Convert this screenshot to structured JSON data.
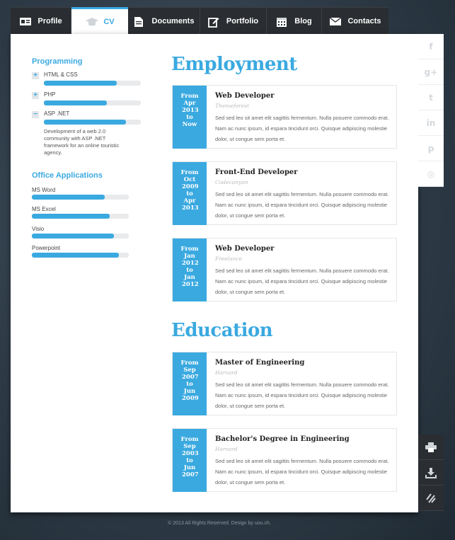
{
  "tabs": [
    {
      "label": "Profile",
      "icon": "id-card-icon"
    },
    {
      "label": "CV",
      "icon": "graduation-cap-icon"
    },
    {
      "label": "Documents",
      "icon": "document-icon"
    },
    {
      "label": "Portfolio",
      "icon": "edit-icon"
    },
    {
      "label": "Blog",
      "icon": "calendar-icon"
    },
    {
      "label": "Contacts",
      "icon": "envelope-icon"
    }
  ],
  "sidebar": {
    "programming_title": "Programming",
    "programming": [
      {
        "toggle": "+",
        "label": "HTML & CSS",
        "level": 0.75
      },
      {
        "toggle": "+",
        "label": "PHP",
        "level": 0.65
      },
      {
        "toggle": "−",
        "label": "ASP .NET",
        "level": 0.85,
        "description": "Development of a web 2.0 community with ASP .NET framework for an online touristic agency."
      }
    ],
    "office_title": "Office Applications",
    "office": [
      {
        "label": "MS Word",
        "level": 0.75
      },
      {
        "label": "MS Excel",
        "level": 0.8
      },
      {
        "label": "Visio",
        "level": 0.85
      },
      {
        "label": "Powerpoint",
        "level": 0.9
      }
    ]
  },
  "employment": {
    "title": "Employment",
    "entries": [
      {
        "from_label": "From",
        "from": "Apr 2013",
        "to_label": "to",
        "to": "Now",
        "title": "Web Developer",
        "org": "Themeforest",
        "body": "Sed sed leo sit amet elit sagittis fermentum. Nulla posuere commodo erat. Nam ac nunc ipsum, id espara tincidunt orci. Quisque adipiscing molestie dolor, ut congue sem porta et."
      },
      {
        "from_label": "From",
        "from": "Oct 2009",
        "to_label": "to",
        "to": "Apr 2013",
        "title": "Front-End Developer",
        "org": "Codecanyon",
        "body": "Sed sed leo sit amet elit sagittis fermentum. Nulla posuere commodo erat. Nam ac nunc ipsum, id espara tincidunt orci. Quisque adipiscing molestie dolor, ut congue sem porta et."
      },
      {
        "from_label": "From",
        "from": "Jan 2012",
        "to_label": "to",
        "to": "Jan 2012",
        "title": "Web Developer",
        "org": "Freelance",
        "body": "Sed sed leo sit amet elit sagittis fermentum. Nulla posuere commodo erat. Nam ac nunc ipsum, id espara tincidunt orci. Quisque adipiscing molestie dolor, ut congue sem porta et."
      }
    ]
  },
  "education": {
    "title": "Education",
    "entries": [
      {
        "from_label": "From",
        "from": "Sep 2007",
        "to_label": "to",
        "to": "Jun 2009",
        "title": "Master of Engineering",
        "org": "Harvard",
        "body": "Sed sed leo sit amet elit sagittis fermentum. Nulla posuere commodo erat. Nam ac nunc ipsum, id espara tincidunt orci. Quisque adipiscing molestie dolor, ut congue sem porta et."
      },
      {
        "from_label": "From",
        "from": "Sep 2003",
        "to_label": "to",
        "to": "Jun 2007",
        "title": "Bachelor's Degree in Engineering",
        "org": "Harvard",
        "body": "Sed sed leo sit amet elit sagittis fermentum. Nulla posuere commodo erat. Nam ac nunc ipsum, id espara tincidunt orci. Quisque adipiscing molestie dolor, ut congue sem porta et."
      }
    ]
  },
  "social": [
    {
      "glyph": "f",
      "icon": "facebook-icon"
    },
    {
      "glyph": "g+",
      "icon": "google-plus-icon"
    },
    {
      "glyph": "t",
      "icon": "twitter-icon"
    },
    {
      "glyph": "in",
      "icon": "linkedin-icon"
    },
    {
      "glyph": "p",
      "icon": "pinterest-icon"
    },
    {
      "glyph": "◎",
      "icon": "dribbble-icon"
    }
  ],
  "tools": [
    {
      "icon": "print-icon"
    },
    {
      "icon": "download-icon"
    },
    {
      "icon": "share-icon"
    }
  ],
  "footer": "© 2013 All Rights Reserved. Design by uou.ch.",
  "colors": {
    "accent": "#3aa9e0",
    "dark": "#2a2d31"
  }
}
